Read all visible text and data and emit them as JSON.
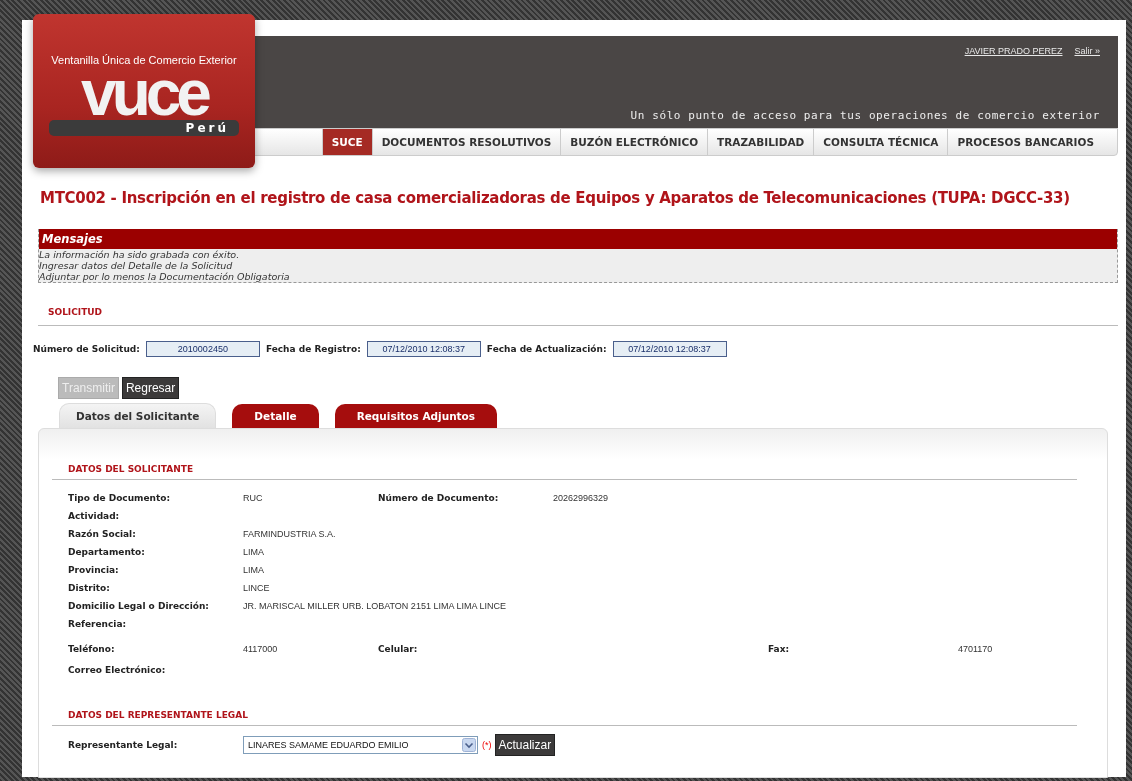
{
  "logo": {
    "tagline": "Ventanilla Única de Comercio Exterior",
    "name": "vuce",
    "country": "Perú"
  },
  "user": {
    "name": "JAVIER PRADO PEREZ",
    "logout": "Salir »"
  },
  "slogan": "Un sólo punto de acceso para tus operaciones de comercio exterior",
  "nav": [
    {
      "label": "SUCE",
      "selected": true
    },
    {
      "label": "DOCUMENTOS RESOLUTIVOS",
      "selected": false
    },
    {
      "label": "BUZÓN ELECTRÓNICO",
      "selected": false
    },
    {
      "label": "TRAZABILIDAD",
      "selected": false
    },
    {
      "label": "CONSULTA TÉCNICA",
      "selected": false
    },
    {
      "label": "PROCESOS BANCARIOS",
      "selected": false
    }
  ],
  "page_title": "MTC002 - Inscripción en el registro de casa comercializadoras de Equipos y Aparatos de Telecomunicaciones (TUPA: DGCC-33)",
  "messages": {
    "title": "Mensajes",
    "lines": [
      "La información ha sido grabada con éxito.",
      "Ingresar datos del Detalle de la Solicitud",
      "Adjuntar por lo menos la Documentación Obligatoria"
    ]
  },
  "solicitud": {
    "heading": "SOLICITUD",
    "fields": [
      {
        "label": "Número de Solicitud:",
        "value": "2010002450"
      },
      {
        "label": "Fecha de Registro:",
        "value": "07/12/2010 12:08:37"
      },
      {
        "label": "Fecha de Actualización:",
        "value": "07/12/2010 12:08:37"
      }
    ]
  },
  "actions": [
    {
      "label": "Transmitir",
      "disabled": true
    },
    {
      "label": "Regresar",
      "disabled": false
    }
  ],
  "tabs": [
    {
      "label": "Datos del Solicitante",
      "selected": true
    },
    {
      "label": "Detalle",
      "selected": false
    },
    {
      "label": "Requisitos Adjuntos",
      "selected": false
    }
  ],
  "solicitante": {
    "heading": "DATOS DEL SOLICITANTE",
    "rows": [
      [
        {
          "label": "Tipo de Documento:",
          "value": "RUC"
        },
        {
          "label": "Número de Documento:",
          "value": "20262996329"
        }
      ],
      [
        {
          "label": "Actividad:"
        }
      ],
      [
        {
          "label": "Razón Social:",
          "value": "FARMINDUSTRIA S.A."
        }
      ],
      [
        {
          "label": "Departamento:",
          "value": "LIMA"
        }
      ],
      [
        {
          "label": "Provincia:",
          "value": "LIMA"
        }
      ],
      [
        {
          "label": "Distrito:",
          "value": "LINCE"
        }
      ],
      [
        {
          "label": "Domicilio Legal o Dirección:",
          "value": "JR. MARISCAL MILLER URB. LOBATON 2151 LIMA LIMA LINCE"
        }
      ],
      [
        {
          "label": "Referencia:"
        }
      ],
      [
        {
          "label": "Teléfono:",
          "value": "4117000"
        },
        {
          "label": "Celular:"
        },
        {
          "label": "Fax:",
          "value": "4701170"
        }
      ],
      [
        {
          "label": "Correo Electrónico:"
        }
      ]
    ]
  },
  "representante": {
    "heading": "DATOS DEL REPRESENTANTE LEGAL",
    "label": "Representante Legal:",
    "value": "LINARES SAMAME EDUARDO EMILIO",
    "required": "(*)",
    "button": "Actualizar"
  }
}
